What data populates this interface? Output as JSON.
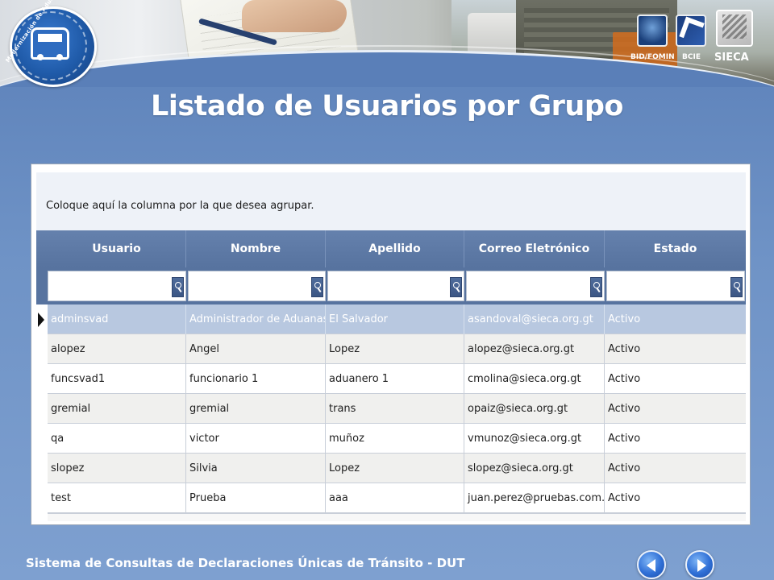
{
  "header": {
    "logo_left_text": "Modernización de Aduanas y Pasos Fronterizos",
    "logos_right": [
      {
        "label": "BID/FOMIN",
        "icon": "bid-fomin-logo-icon"
      },
      {
        "label": "BCIE",
        "icon": "bcie-logo-icon"
      },
      {
        "label": "SIECA",
        "icon": "sieca-logo-icon"
      }
    ]
  },
  "page_title": "Listado de Usuarios por Grupo",
  "grid": {
    "group_prompt": "Coloque aquí la columna por la que desea agrupar.",
    "columns": [
      "Usuario",
      "Nombre",
      "Apellido",
      "Correo Eletrónico",
      "Estado"
    ],
    "filters": [
      "",
      "",
      "",
      "",
      ""
    ],
    "rows": [
      {
        "usuario": "adminsvad",
        "nombre": "Administrador de Aduanas",
        "apellido": "El Salvador",
        "correo": "asandoval@sieca.org.gt",
        "estado": "Activo",
        "selected": true
      },
      {
        "usuario": "alopez",
        "nombre": "Angel",
        "apellido": "Lopez",
        "correo": "alopez@sieca.org.gt",
        "estado": "Activo"
      },
      {
        "usuario": "funcsvad1",
        "nombre": "funcionario 1",
        "apellido": "aduanero 1",
        "correo": "cmolina@sieca.org.gt",
        "estado": "Activo"
      },
      {
        "usuario": "gremial",
        "nombre": "gremial",
        "apellido": "trans",
        "correo": "opaiz@sieca.org.gt",
        "estado": "Activo"
      },
      {
        "usuario": "qa",
        "nombre": "victor",
        "apellido": "muñoz",
        "correo": "vmunoz@sieca.org.gt",
        "estado": "Activo"
      },
      {
        "usuario": "slopez",
        "nombre": "Silvia",
        "apellido": "Lopez",
        "correo": "slopez@sieca.org.gt",
        "estado": "Activo"
      },
      {
        "usuario": "test",
        "nombre": "Prueba",
        "apellido": "aaa",
        "correo": "juan.perez@pruebas.com.gt",
        "estado": "Activo"
      }
    ]
  },
  "footer": {
    "text": "Sistema de Consultas de Declaraciones Únicas de Tránsito - DUT",
    "prev_icon": "arrow-left-icon",
    "next_icon": "arrow-right-icon"
  },
  "colors": {
    "background": "#6f93c6",
    "grid_header": "#5f7ba8",
    "selected_row": "#b8c8e0",
    "nav_button": "#2f6fd6"
  }
}
